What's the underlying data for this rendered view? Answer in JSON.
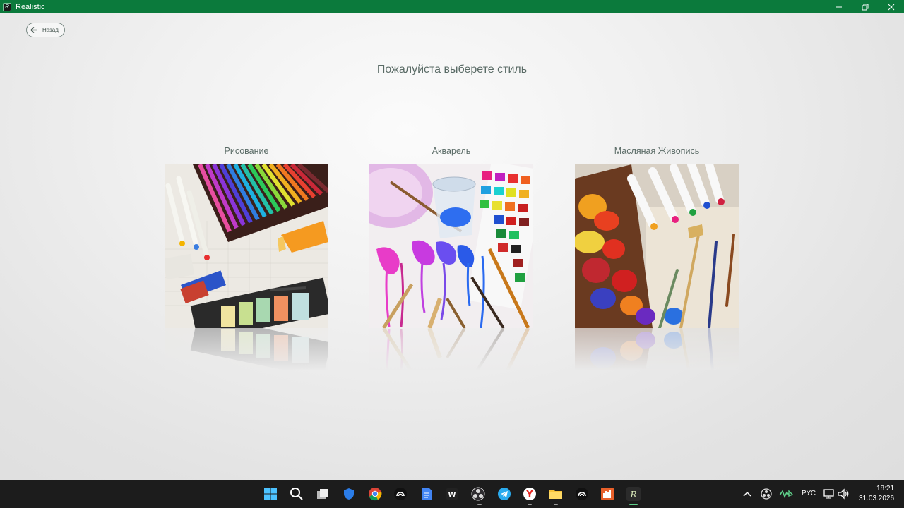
{
  "window": {
    "title": "Realistic",
    "app_icon_glyph": "R"
  },
  "back_button": {
    "label": "Назад"
  },
  "heading": "Пожалуйста выберете стиль",
  "cards": [
    {
      "label": "Рисование",
      "icon": "pencils-image"
    },
    {
      "label": "Акварель",
      "icon": "watercolor-image"
    },
    {
      "label": "Масляная Живопись",
      "icon": "oil-paint-image"
    }
  ],
  "taskbar": {
    "apps": [
      "windows-start",
      "search",
      "task-view",
      "defender",
      "chrome",
      "app-1",
      "docs",
      "winamp",
      "obs",
      "telegram",
      "yandex-browser",
      "file-explorer",
      "app-2",
      "sound-app",
      "realistic"
    ],
    "tray": {
      "language": "РУС",
      "time": "18:21",
      "date": "31.03.2026"
    }
  },
  "colors": {
    "titlebar": "#0b7a3c",
    "text": "#5a6b66",
    "taskbar": "#1c1c1c"
  }
}
